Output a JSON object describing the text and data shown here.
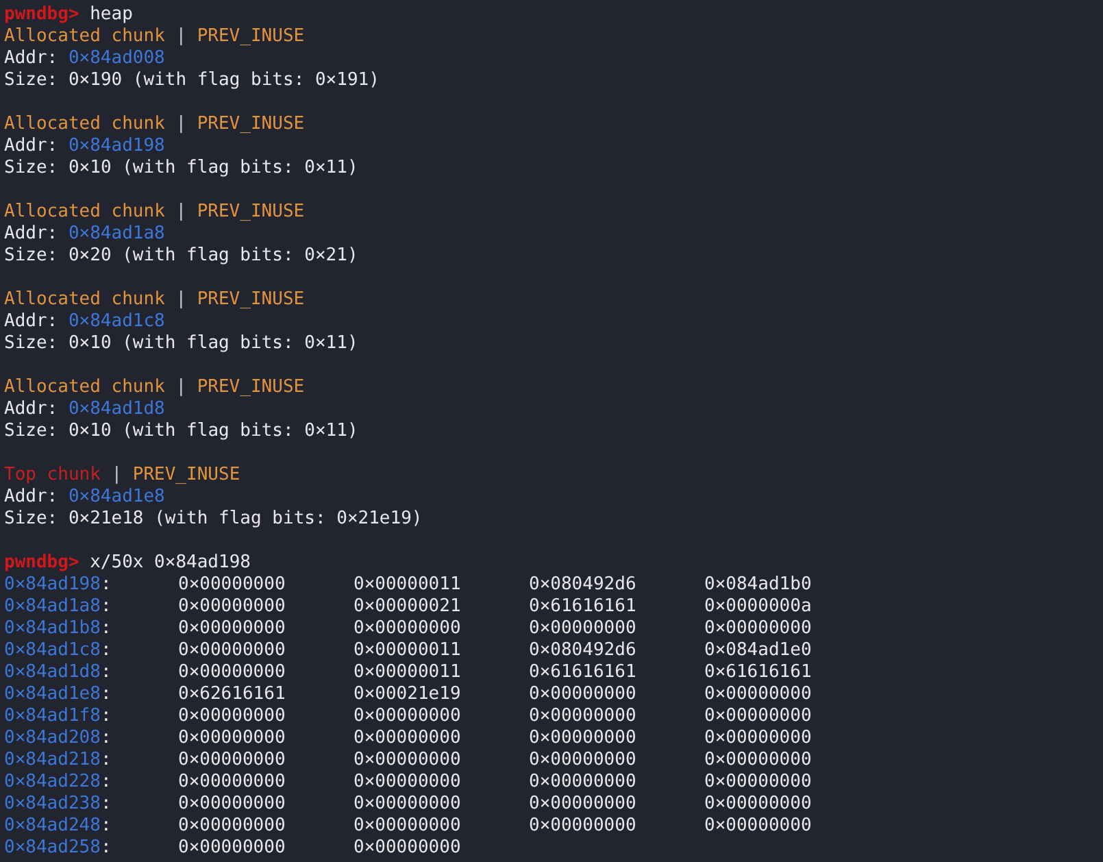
{
  "commands": [
    {
      "prompt": "pwndbg>",
      "command": "heap"
    },
    {
      "prompt": "pwndbg>",
      "command": "x/50x 0×84ad198"
    }
  ],
  "chunks": [
    {
      "kind": "allocated",
      "title": "Allocated chunk",
      "separator": "|",
      "flag": "PREV_INUSE",
      "addr_label": "Addr:",
      "addr": "0×84ad008",
      "size": "Size: 0×190 (with flag bits: 0×191)"
    },
    {
      "kind": "allocated",
      "title": "Allocated chunk",
      "separator": "|",
      "flag": "PREV_INUSE",
      "addr_label": "Addr:",
      "addr": "0×84ad198",
      "size": "Size: 0×10 (with flag bits: 0×11)"
    },
    {
      "kind": "allocated",
      "title": "Allocated chunk",
      "separator": "|",
      "flag": "PREV_INUSE",
      "addr_label": "Addr:",
      "addr": "0×84ad1a8",
      "size": "Size: 0×20 (with flag bits: 0×21)"
    },
    {
      "kind": "allocated",
      "title": "Allocated chunk",
      "separator": "|",
      "flag": "PREV_INUSE",
      "addr_label": "Addr:",
      "addr": "0×84ad1c8",
      "size": "Size: 0×10 (with flag bits: 0×11)"
    },
    {
      "kind": "allocated",
      "title": "Allocated chunk",
      "separator": "|",
      "flag": "PREV_INUSE",
      "addr_label": "Addr:",
      "addr": "0×84ad1d8",
      "size": "Size: 0×10 (with flag bits: 0×11)"
    },
    {
      "kind": "top",
      "title": "Top chunk",
      "separator": "|",
      "flag": "PREV_INUSE",
      "addr_label": "Addr:",
      "addr": "0×84ad1e8",
      "size": "Size: 0×21e18 (with flag bits: 0×21e19)"
    }
  ],
  "dump": [
    {
      "address": "0×84ad198",
      "colon": ":",
      "words": [
        "0×00000000",
        "0×00000011",
        "0×080492d6",
        "0×084ad1b0"
      ]
    },
    {
      "address": "0×84ad1a8",
      "colon": ":",
      "words": [
        "0×00000000",
        "0×00000021",
        "0×61616161",
        "0×0000000a"
      ]
    },
    {
      "address": "0×84ad1b8",
      "colon": ":",
      "words": [
        "0×00000000",
        "0×00000000",
        "0×00000000",
        "0×00000000"
      ]
    },
    {
      "address": "0×84ad1c8",
      "colon": ":",
      "words": [
        "0×00000000",
        "0×00000011",
        "0×080492d6",
        "0×084ad1e0"
      ]
    },
    {
      "address": "0×84ad1d8",
      "colon": ":",
      "words": [
        "0×00000000",
        "0×00000011",
        "0×61616161",
        "0×61616161"
      ]
    },
    {
      "address": "0×84ad1e8",
      "colon": ":",
      "words": [
        "0×62616161",
        "0×00021e19",
        "0×00000000",
        "0×00000000"
      ]
    },
    {
      "address": "0×84ad1f8",
      "colon": ":",
      "words": [
        "0×00000000",
        "0×00000000",
        "0×00000000",
        "0×00000000"
      ]
    },
    {
      "address": "0×84ad208",
      "colon": ":",
      "words": [
        "0×00000000",
        "0×00000000",
        "0×00000000",
        "0×00000000"
      ]
    },
    {
      "address": "0×84ad218",
      "colon": ":",
      "words": [
        "0×00000000",
        "0×00000000",
        "0×00000000",
        "0×00000000"
      ]
    },
    {
      "address": "0×84ad228",
      "colon": ":",
      "words": [
        "0×00000000",
        "0×00000000",
        "0×00000000",
        "0×00000000"
      ]
    },
    {
      "address": "0×84ad238",
      "colon": ":",
      "words": [
        "0×00000000",
        "0×00000000",
        "0×00000000",
        "0×00000000"
      ]
    },
    {
      "address": "0×84ad248",
      "colon": ":",
      "words": [
        "0×00000000",
        "0×00000000",
        "0×00000000",
        "0×00000000"
      ]
    },
    {
      "address": "0×84ad258",
      "colon": ":",
      "words": [
        "0×00000000",
        "0×00000000"
      ]
    }
  ]
}
